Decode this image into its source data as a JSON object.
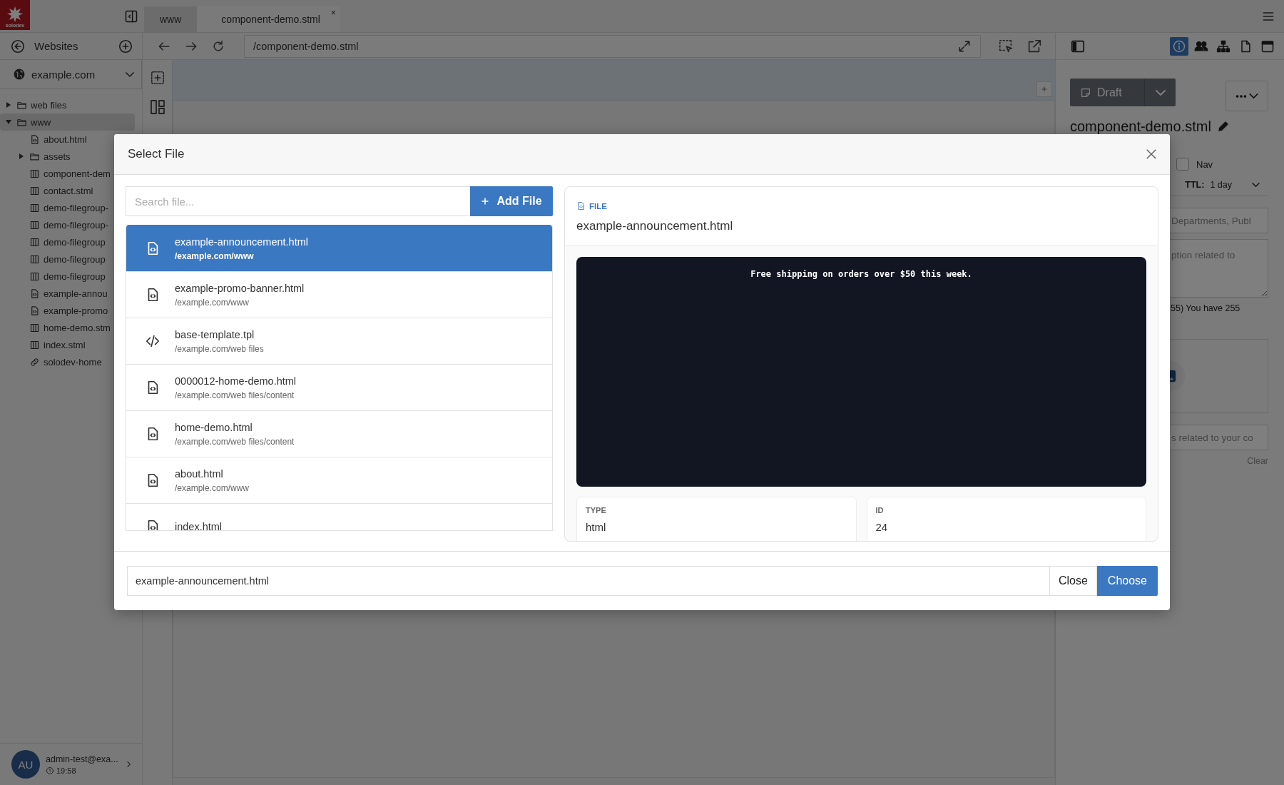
{
  "logo": {
    "text": "solodev"
  },
  "tabs": [
    {
      "label": "www",
      "selected": false
    },
    {
      "label": "component-demo.stml",
      "selected": true,
      "close": "×"
    }
  ],
  "sidebar": {
    "title": "Websites",
    "site": "example.com",
    "tree": [
      {
        "label": "web files",
        "kind": "folder",
        "expanded": false,
        "selected": false
      },
      {
        "label": "www",
        "kind": "folder",
        "expanded": true,
        "selected": true,
        "children": [
          {
            "label": "about.html",
            "kind": "html",
            "selected": false
          },
          {
            "label": "assets",
            "kind": "folder",
            "expanded": false,
            "selected": false
          },
          {
            "label": "component-dem",
            "kind": "stml",
            "selected": false
          },
          {
            "label": "contact.stml",
            "kind": "stml",
            "selected": false
          },
          {
            "label": "demo-filegroup-",
            "kind": "stml",
            "selected": false
          },
          {
            "label": "demo-filegroup-",
            "kind": "stml",
            "selected": false
          },
          {
            "label": "demo-filegroup",
            "kind": "stml",
            "selected": false
          },
          {
            "label": "demo-filegroup",
            "kind": "stml",
            "selected": false
          },
          {
            "label": "demo-filegroup",
            "kind": "stml",
            "selected": false
          },
          {
            "label": "example-annou",
            "kind": "html",
            "selected": false
          },
          {
            "label": "example-promo",
            "kind": "html",
            "selected": false
          },
          {
            "label": "home-demo.stm",
            "kind": "stml",
            "selected": false
          },
          {
            "label": "index.stml",
            "kind": "stml",
            "selected": false
          },
          {
            "label": "solodev-home",
            "kind": "link",
            "selected": false
          }
        ]
      }
    ]
  },
  "user": {
    "initials": "AU",
    "name": "admin-test@exa...",
    "time": "19:58"
  },
  "address_bar": {
    "url": "/component-demo.stml"
  },
  "panel_tabs": [
    {
      "selected": true
    },
    {
      "selected": false
    },
    {
      "selected": false
    },
    {
      "selected": false
    },
    {
      "selected": false
    }
  ],
  "properties": {
    "status": "Draft",
    "title": "component-demo.stml",
    "nav": {
      "label": "Nav",
      "checked": false
    },
    "ttl": {
      "label": "TTL:",
      "value": "1 day"
    },
    "fields": [
      {
        "kind": "input",
        "placeholder": "Departments, Publ"
      },
      {
        "kind": "textarea",
        "placeholder": "ption related to"
      },
      {
        "kind": "note",
        "text": "55) You have 255"
      },
      {
        "kind": "dropzone"
      },
      {
        "kind": "input",
        "placeholder": "s related to your co"
      },
      {
        "kind": "link",
        "text": "Clear"
      }
    ]
  },
  "modal": {
    "title": "Select File",
    "search_placeholder": "Search file...",
    "add_button": "Add File",
    "files": [
      {
        "name": "example-announcement.html",
        "path": "/example.com/www",
        "kind": "html",
        "selected": true
      },
      {
        "name": "example-promo-banner.html",
        "path": "/example.com/www",
        "kind": "html",
        "selected": false
      },
      {
        "name": "base-template.tpl",
        "path": "/example.com/web files",
        "kind": "code",
        "selected": false
      },
      {
        "name": "0000012-home-demo.html",
        "path": "/example.com/web files/content",
        "kind": "html",
        "selected": false
      },
      {
        "name": "home-demo.html",
        "path": "/example.com/web files/content",
        "kind": "html",
        "selected": false
      },
      {
        "name": "about.html",
        "path": "/example.com/www",
        "kind": "html",
        "selected": false
      },
      {
        "name": "index.html",
        "kind": "html",
        "selected": false
      }
    ],
    "preview": {
      "label": "FILE",
      "name": "example-announcement.html",
      "banner": "Free shipping on orders over $50 this week.",
      "meta": [
        {
          "label": "TYPE",
          "value": "html"
        },
        {
          "label": "ID",
          "value": "24"
        }
      ]
    },
    "footer": {
      "value": "example-announcement.html",
      "close": "Close",
      "choose": "Choose"
    }
  }
}
